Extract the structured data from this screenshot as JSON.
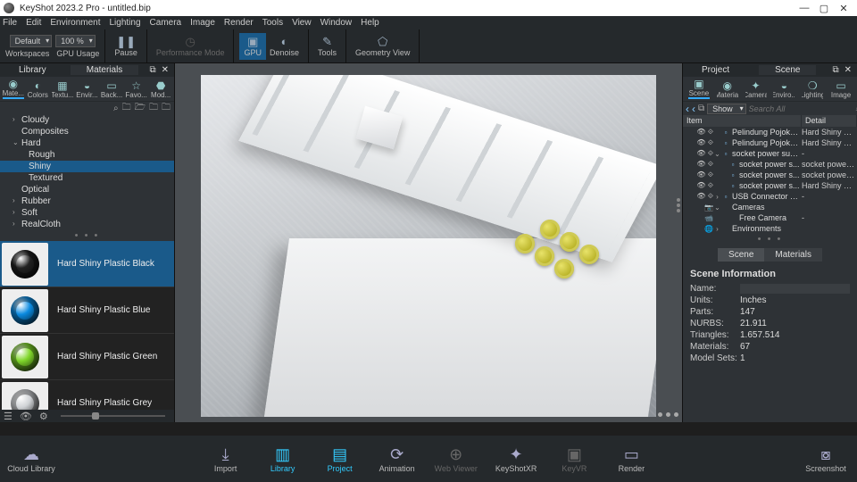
{
  "app": {
    "title": "KeyShot 2023.2 Pro  - untitled.bip"
  },
  "winControls": {
    "min": "—",
    "max": "▢",
    "close": "✕"
  },
  "menu": [
    "File",
    "Edit",
    "Environment",
    "Lighting",
    "Camera",
    "Image",
    "Render",
    "Tools",
    "View",
    "Window",
    "Help"
  ],
  "ribbon": {
    "preset": "Default",
    "zoom": "100 %",
    "workspaces": "Workspaces",
    "gpuUsage": "GPU Usage",
    "pause": "Pause",
    "perf": "Performance Mode",
    "gpu": "GPU",
    "denoise": "Denoise",
    "tools": "Tools",
    "geom": "Geometry View"
  },
  "library": {
    "headTabs": {
      "a": "Library",
      "b": "Materials"
    },
    "iconRow": [
      {
        "ic": "◉",
        "lbl": "Mate..."
      },
      {
        "ic": "◐",
        "lbl": "Colors"
      },
      {
        "ic": "▦",
        "lbl": "Textu..."
      },
      {
        "ic": "◒",
        "lbl": "Envir..."
      },
      {
        "ic": "▭",
        "lbl": "Back..."
      },
      {
        "ic": "☆",
        "lbl": "Favo..."
      },
      {
        "ic": "⬣",
        "lbl": "Mod..."
      }
    ],
    "tree": [
      {
        "lvl": 0,
        "caret": "›",
        "label": "Cloudy"
      },
      {
        "lvl": 0,
        "caret": "",
        "label": "Composites"
      },
      {
        "lvl": 0,
        "caret": "⌄",
        "label": "Hard"
      },
      {
        "lvl": 1,
        "caret": "",
        "label": "Rough"
      },
      {
        "lvl": 1,
        "caret": "",
        "label": "Shiny",
        "sel": true
      },
      {
        "lvl": 1,
        "caret": "",
        "label": "Textured"
      },
      {
        "lvl": 0,
        "caret": "",
        "label": "Optical"
      },
      {
        "lvl": 0,
        "caret": "›",
        "label": "Rubber"
      },
      {
        "lvl": 0,
        "caret": "›",
        "label": "Soft"
      },
      {
        "lvl": 0,
        "caret": "›",
        "label": "RealCloth"
      }
    ],
    "materials": [
      {
        "name": "Hard Shiny Plastic Black",
        "color": "#222",
        "sel": true
      },
      {
        "name": "Hard Shiny Plastic Blue",
        "color": "#0a8ae0"
      },
      {
        "name": "Hard Shiny Plastic Green",
        "color": "#7fd62a"
      },
      {
        "name": "Hard Shiny Plastic Grey",
        "color": "#d0d3d6"
      }
    ]
  },
  "project": {
    "headTabs": {
      "a": "Project",
      "b": "Scene"
    },
    "iconRow": [
      {
        "ic": "▣",
        "lbl": "Scene"
      },
      {
        "ic": "◉",
        "lbl": "Material"
      },
      {
        "ic": "✦",
        "lbl": "Camera"
      },
      {
        "ic": "◒",
        "lbl": "Enviro..."
      },
      {
        "ic": "❍",
        "lbl": "Lighting"
      },
      {
        "ic": "▭",
        "lbl": "Image"
      }
    ],
    "showLabel": "Show",
    "searchPlaceholder": "Search All",
    "columns": {
      "item": "Item",
      "detail": "Detail"
    },
    "rows": [
      {
        "ind": 0,
        "caret": "",
        "eye": true,
        "name": "Pelindung Pojokka...",
        "detail": "Hard Shiny Plas..."
      },
      {
        "ind": 0,
        "caret": "",
        "eye": true,
        "name": "Pelindung Pojokka...",
        "detail": "Hard Shiny Plas..."
      },
      {
        "ind": 0,
        "caret": "⌄",
        "eye": true,
        "name": "socket power supp...",
        "detail": "-"
      },
      {
        "ind": 1,
        "caret": "",
        "eye": true,
        "name": "socket power s...",
        "detail": "socket power s..."
      },
      {
        "ind": 1,
        "caret": "",
        "eye": true,
        "name": "socket power s...",
        "detail": "socket power s..."
      },
      {
        "ind": 1,
        "caret": "",
        "eye": true,
        "name": "socket power s...",
        "detail": "Hard Shiny Plas..."
      },
      {
        "ind": 0,
        "caret": "›",
        "eye": true,
        "name": "USB Connector Ty...",
        "detail": "-"
      },
      {
        "ind": 0,
        "caret": "⌄",
        "eye": false,
        "cam": true,
        "name": "Cameras",
        "detail": ""
      },
      {
        "ind": 1,
        "caret": "",
        "eye": false,
        "name": "Free Camera",
        "detail": "-",
        "camc": true
      },
      {
        "ind": 0,
        "caret": "›",
        "eye": false,
        "env": true,
        "name": "Environments",
        "detail": ""
      }
    ],
    "subTabs": {
      "scene": "Scene",
      "materials": "Materials"
    },
    "info": {
      "title": "Scene Information",
      "rows": [
        {
          "k": "Name:",
          "box": true
        },
        {
          "k": "Units:",
          "v": "Inches"
        },
        {
          "k": "Parts:",
          "v": "147"
        },
        {
          "k": "NURBS:",
          "v": "21.911"
        },
        {
          "k": "Triangles:",
          "v": "1.657.514"
        },
        {
          "k": "Materials:",
          "v": "67"
        },
        {
          "k": "Model Sets:",
          "v": "1"
        }
      ]
    }
  },
  "bottom": {
    "cloud": "Cloud Library",
    "items": [
      {
        "lbl": "Import",
        "ic": "⤓"
      },
      {
        "lbl": "Library",
        "ic": "▥",
        "act": true
      },
      {
        "lbl": "Project",
        "ic": "▤",
        "act": true
      },
      {
        "lbl": "Animation",
        "ic": "⟳"
      },
      {
        "lbl": "Web Viewer",
        "ic": "⊕",
        "dis": true
      },
      {
        "lbl": "KeyShotXR",
        "ic": "✦"
      },
      {
        "lbl": "KeyVR",
        "ic": "▣",
        "dis": true
      },
      {
        "lbl": "Render",
        "ic": "▭"
      }
    ],
    "screenshot": "Screenshot"
  }
}
